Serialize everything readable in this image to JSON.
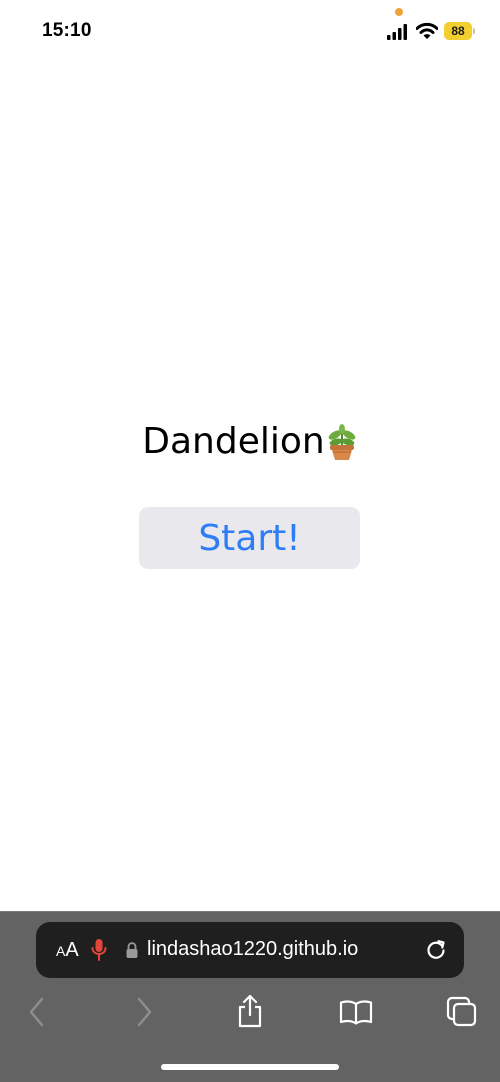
{
  "status_bar": {
    "time": "15:10",
    "battery_level": "88",
    "icons": [
      "signal-icon",
      "wifi-icon",
      "battery-icon"
    ],
    "colors": {
      "battery": "#f2cf2e",
      "privacy_dot": "#f2a23b"
    }
  },
  "main": {
    "title": "Dandelion",
    "title_emoji_icon": "potted-plant-icon",
    "start_button_label": "Start!",
    "colors": {
      "button_background": "#e9e9ed",
      "button_text": "#2e7cf6"
    }
  },
  "browser": {
    "text_size_label_small": "A",
    "text_size_label_large": "A",
    "url": "lindashao1220.github.io",
    "address_icons": [
      "text-size-icon",
      "microphone-icon",
      "lock-icon",
      "reload-icon"
    ],
    "toolbar_icons": [
      "back-icon",
      "forward-icon",
      "share-icon",
      "bookmarks-icon",
      "tabs-icon"
    ],
    "colors": {
      "toolbar_background": "#636363",
      "address_background": "#1f1f1f",
      "microphone": "#e2453c"
    }
  }
}
